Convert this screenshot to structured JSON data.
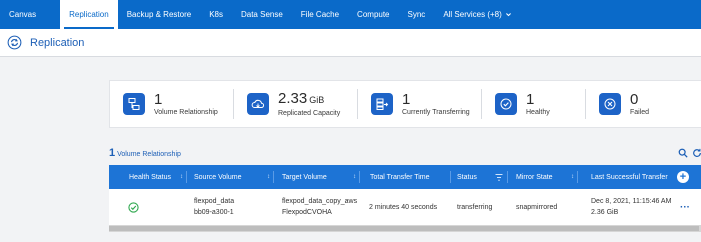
{
  "nav": {
    "items": [
      "Canvas",
      "Replication",
      "Backup & Restore",
      "K8s",
      "Data Sense",
      "File Cache",
      "Compute",
      "Sync",
      "All Services (+8)"
    ],
    "active": "Replication"
  },
  "header": {
    "title": "Replication"
  },
  "summary": [
    {
      "value": "1",
      "unit": "",
      "label": "Volume Relationship",
      "icon": "volume-relationship-icon"
    },
    {
      "value": "2.33",
      "unit": "GiB",
      "label": "Replicated Capacity",
      "icon": "cloud-capacity-icon"
    },
    {
      "value": "1",
      "unit": "",
      "label": "Currently Transferring",
      "icon": "transfer-icon"
    },
    {
      "value": "1",
      "unit": "",
      "label": "Healthy",
      "icon": "healthy-check-icon"
    },
    {
      "value": "0",
      "unit": "",
      "label": "Failed",
      "icon": "failed-x-icon"
    }
  ],
  "relationships": {
    "count": "1",
    "label": "Volume Relationship",
    "columns": [
      "Health Status",
      "Source Volume",
      "Target Volume",
      "Total Transfer Time",
      "Status",
      "Mirror State",
      "Last Successful Transfer"
    ],
    "rows": [
      {
        "health": "healthy",
        "source_line1": "flexpod_data",
        "source_line2": "bb09-a300-1",
        "target_line1": "flexpod_data_copy_aws",
        "target_line2": "FlexpodCVOHA",
        "transfer_time": "2 minutes 40 seconds",
        "status": "transferring",
        "mirror_state": "snapmirrored",
        "last_transfer_line1": "Dec 8, 2021, 11:15:46 AM",
        "last_transfer_line2": "2.36 GiB"
      }
    ]
  },
  "colors": {
    "nav": "#0a6ac9",
    "accent": "#1d74d6",
    "healthy": "#2fa84f"
  }
}
